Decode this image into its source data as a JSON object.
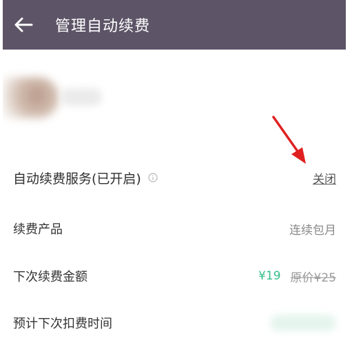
{
  "header": {
    "title": "管理自动续费",
    "back_icon": "arrow-left-icon",
    "background": "#5e5467"
  },
  "subscription": {
    "service_label": "自动续费服务(已开启)",
    "info_icon": "info-icon",
    "close_label": "关闭"
  },
  "details": {
    "product_label": "续费产品",
    "product_value": "连续包月",
    "amount_label": "下次续费金额",
    "amount_now": "¥19",
    "amount_original": "原价¥25",
    "next_time_label": "预计下次扣费时间"
  },
  "colors": {
    "price_accent": "#37c08c",
    "annotation_arrow": "#e02020"
  }
}
